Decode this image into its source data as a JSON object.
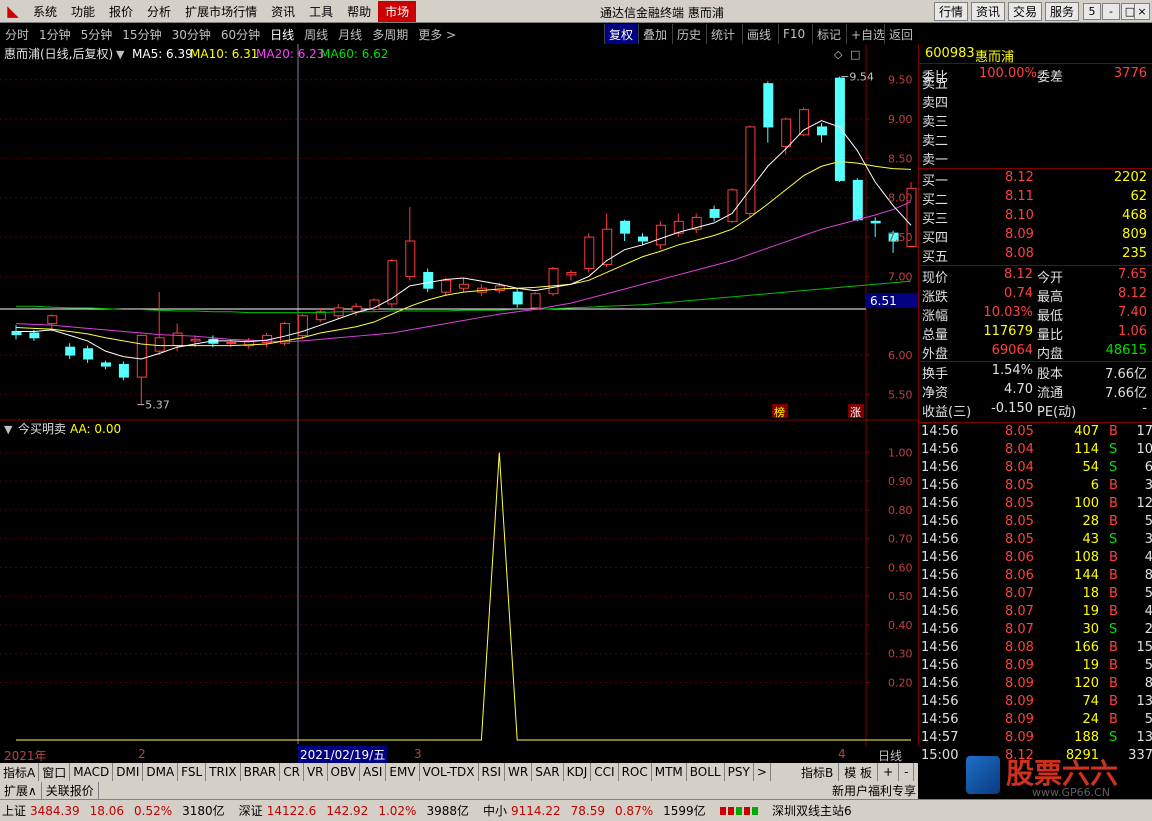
{
  "menubar": {
    "items": [
      "系统",
      "功能",
      "报价",
      "分析",
      "扩展市场行情",
      "资讯",
      "工具",
      "帮助",
      "市场"
    ],
    "title": "通达信金融终端 惠而浦",
    "right_buttons": [
      "行情",
      "资讯",
      "交易",
      "服务"
    ],
    "window_buttons": [
      "5",
      "-",
      "□",
      "×"
    ]
  },
  "toolbar": {
    "periods": [
      "分时",
      "1分钟",
      "5分钟",
      "15分钟",
      "30分钟",
      "60分钟",
      "日线",
      "周线",
      "月线",
      "多周期",
      "更多 >"
    ],
    "selected": "日线",
    "right_tools": [
      "复权",
      "叠加",
      "历史",
      "统计",
      "画线",
      "F10",
      "标记",
      "+自选",
      "返回"
    ]
  },
  "chart": {
    "stock_title": "惠而浦(日线,后复权)",
    "ma_labels": [
      {
        "text": "MA5: 6.39",
        "color": "#ffffff"
      },
      {
        "text": "MA10: 6.31",
        "color": "#ffff00"
      },
      {
        "text": "MA20: 6.23",
        "color": "#ff40ff"
      },
      {
        "text": "MA60: 6.62",
        "color": "#00e000"
      }
    ],
    "price_axis": [
      "9.50",
      "9.00",
      "8.50",
      "8.00",
      "7.50",
      "7.00",
      "6.51",
      "6.00",
      "5.50"
    ],
    "high_label": "9.54",
    "low_label": "5.37",
    "badges": [
      "榜",
      "涨"
    ],
    "indicator_title": "今买明卖",
    "indicator_value": "AA: 0.00",
    "indicator_axis": [
      "1.00",
      "0.90",
      "0.80",
      "0.70",
      "0.60",
      "0.50",
      "0.40",
      "0.30",
      "0.20"
    ],
    "date_labels": [
      "2021年",
      "2",
      "2021/02/19/五",
      "3",
      "4"
    ],
    "period_label": "日线"
  },
  "chart_data": {
    "type": "candlestick",
    "title": "惠而浦(日线,后复权)",
    "ylim": [
      5.2,
      9.7
    ],
    "candles": [
      {
        "o": 6.3,
        "c": 6.26,
        "h": 6.38,
        "l": 6.2
      },
      {
        "o": 6.28,
        "c": 6.22,
        "h": 6.32,
        "l": 6.18
      },
      {
        "o": 6.4,
        "c": 6.5,
        "h": 6.52,
        "l": 6.3
      },
      {
        "o": 6.1,
        "c": 6.0,
        "h": 6.15,
        "l": 5.95
      },
      {
        "o": 6.08,
        "c": 5.95,
        "h": 6.12,
        "l": 5.9
      },
      {
        "o": 5.9,
        "c": 5.86,
        "h": 5.93,
        "l": 5.82
      },
      {
        "o": 5.88,
        "c": 5.72,
        "h": 5.92,
        "l": 5.68
      },
      {
        "o": 5.72,
        "c": 6.25,
        "h": 6.26,
        "l": 5.37
      },
      {
        "o": 6.05,
        "c": 6.22,
        "h": 6.8,
        "l": 6.0
      },
      {
        "o": 6.12,
        "c": 6.28,
        "h": 6.4,
        "l": 6.05
      },
      {
        "o": 6.18,
        "c": 6.2,
        "h": 6.25,
        "l": 6.1
      },
      {
        "o": 6.2,
        "c": 6.15,
        "h": 6.25,
        "l": 6.1
      },
      {
        "o": 6.15,
        "c": 6.16,
        "h": 6.2,
        "l": 6.1
      },
      {
        "o": 6.12,
        "c": 6.18,
        "h": 6.22,
        "l": 6.08
      },
      {
        "o": 6.16,
        "c": 6.25,
        "h": 6.28,
        "l": 6.1
      },
      {
        "o": 6.15,
        "c": 6.4,
        "h": 6.42,
        "l": 6.12
      },
      {
        "o": 6.25,
        "c": 6.5,
        "h": 6.52,
        "l": 6.2
      },
      {
        "o": 6.45,
        "c": 6.55,
        "h": 6.6,
        "l": 6.42
      },
      {
        "o": 6.5,
        "c": 6.6,
        "h": 6.65,
        "l": 6.46
      },
      {
        "o": 6.55,
        "c": 6.62,
        "h": 6.66,
        "l": 6.5
      },
      {
        "o": 6.58,
        "c": 6.7,
        "h": 6.72,
        "l": 6.55
      },
      {
        "o": 6.65,
        "c": 7.2,
        "h": 7.22,
        "l": 6.6
      },
      {
        "o": 7.0,
        "c": 7.45,
        "h": 7.88,
        "l": 6.95
      },
      {
        "o": 7.05,
        "c": 6.85,
        "h": 7.1,
        "l": 6.8
      },
      {
        "o": 6.8,
        "c": 6.95,
        "h": 6.98,
        "l": 6.75
      },
      {
        "o": 6.85,
        "c": 6.9,
        "h": 6.98,
        "l": 6.8
      },
      {
        "o": 6.8,
        "c": 6.85,
        "h": 6.9,
        "l": 6.75
      },
      {
        "o": 6.82,
        "c": 6.88,
        "h": 6.92,
        "l": 6.78
      },
      {
        "o": 6.8,
        "c": 6.65,
        "h": 6.85,
        "l": 6.6
      },
      {
        "o": 6.6,
        "c": 6.78,
        "h": 6.8,
        "l": 6.58
      },
      {
        "o": 6.78,
        "c": 7.1,
        "h": 7.12,
        "l": 6.75
      },
      {
        "o": 7.02,
        "c": 7.05,
        "h": 7.08,
        "l": 6.95
      },
      {
        "o": 7.1,
        "c": 7.5,
        "h": 7.55,
        "l": 7.05
      },
      {
        "o": 7.15,
        "c": 7.6,
        "h": 7.8,
        "l": 7.12
      },
      {
        "o": 7.7,
        "c": 7.55,
        "h": 7.72,
        "l": 7.45
      },
      {
        "o": 7.5,
        "c": 7.45,
        "h": 7.55,
        "l": 7.4
      },
      {
        "o": 7.4,
        "c": 7.65,
        "h": 7.7,
        "l": 7.35
      },
      {
        "o": 7.55,
        "c": 7.7,
        "h": 7.8,
        "l": 7.5
      },
      {
        "o": 7.6,
        "c": 7.75,
        "h": 7.8,
        "l": 7.55
      },
      {
        "o": 7.85,
        "c": 7.75,
        "h": 7.9,
        "l": 7.7
      },
      {
        "o": 7.7,
        "c": 8.1,
        "h": 8.12,
        "l": 7.68
      },
      {
        "o": 7.8,
        "c": 8.9,
        "h": 8.92,
        "l": 7.75
      },
      {
        "o": 9.45,
        "c": 8.9,
        "h": 9.48,
        "l": 8.7
      },
      {
        "o": 8.65,
        "c": 9.0,
        "h": 9.02,
        "l": 8.55
      },
      {
        "o": 8.8,
        "c": 9.12,
        "h": 9.15,
        "l": 8.78
      },
      {
        "o": 8.9,
        "c": 8.8,
        "h": 8.95,
        "l": 8.7
      },
      {
        "o": 9.52,
        "c": 8.22,
        "h": 9.54,
        "l": 8.2
      },
      {
        "o": 8.22,
        "c": 7.72,
        "h": 8.25,
        "l": 7.7
      },
      {
        "o": 7.7,
        "c": 7.68,
        "h": 7.75,
        "l": 7.5
      },
      {
        "o": 7.55,
        "c": 7.45,
        "h": 7.58,
        "l": 7.3
      },
      {
        "o": 7.38,
        "c": 8.12,
        "h": 8.2,
        "l": 7.38
      }
    ],
    "ma5": [
      6.3,
      6.3,
      6.32,
      6.25,
      6.18,
      6.05,
      5.98,
      5.95,
      6.02,
      6.1,
      6.14,
      6.18,
      6.18,
      6.17,
      6.19,
      6.24,
      6.3,
      6.38,
      6.46,
      6.54,
      6.6,
      6.72,
      6.88,
      6.92,
      6.96,
      6.98,
      6.94,
      6.9,
      6.85,
      6.82,
      6.86,
      6.9,
      7.0,
      7.2,
      7.34,
      7.4,
      7.48,
      7.56,
      7.62,
      7.68,
      7.8,
      8.1,
      8.4,
      8.62,
      8.86,
      8.98,
      8.9,
      8.6,
      8.2,
      7.9,
      7.65
    ],
    "ma10": [
      6.35,
      6.34,
      6.33,
      6.3,
      6.27,
      6.22,
      6.18,
      6.14,
      6.12,
      6.12,
      6.12,
      6.12,
      6.12,
      6.13,
      6.14,
      6.18,
      6.22,
      6.28,
      6.32,
      6.36,
      6.42,
      6.52,
      6.62,
      6.7,
      6.76,
      6.8,
      6.82,
      6.84,
      6.85,
      6.86,
      6.88,
      6.9,
      6.95,
      7.05,
      7.15,
      7.25,
      7.32,
      7.4,
      7.46,
      7.52,
      7.6,
      7.75,
      7.92,
      8.1,
      8.28,
      8.4,
      8.46,
      8.44,
      8.4,
      8.37,
      8.36
    ],
    "ma20": [
      6.4,
      6.39,
      6.38,
      6.36,
      6.34,
      6.32,
      6.3,
      6.28,
      6.26,
      6.25,
      6.24,
      6.22,
      6.2,
      6.19,
      6.18,
      6.17,
      6.18,
      6.2,
      6.22,
      6.24,
      6.26,
      6.28,
      6.32,
      6.36,
      6.4,
      6.44,
      6.48,
      6.52,
      6.55,
      6.58,
      6.62,
      6.66,
      6.72,
      6.78,
      6.84,
      6.9,
      6.96,
      7.02,
      7.08,
      7.14,
      7.2,
      7.28,
      7.36,
      7.44,
      7.52,
      7.6,
      7.66,
      7.72,
      7.78,
      7.85,
      7.95
    ],
    "ma60": [
      6.62,
      6.62,
      6.61,
      6.6,
      6.6,
      6.59,
      6.58,
      6.58,
      6.57,
      6.56,
      6.56,
      6.55,
      6.55,
      6.54,
      6.54,
      6.54,
      6.54,
      6.54,
      6.55,
      6.55,
      6.55,
      6.56,
      6.56,
      6.56,
      6.56,
      6.57,
      6.57,
      6.57,
      6.58,
      6.58,
      6.59,
      6.6,
      6.61,
      6.62,
      6.63,
      6.64,
      6.66,
      6.68,
      6.7,
      6.72,
      6.74,
      6.76,
      6.78,
      6.8,
      6.82,
      6.84,
      6.86,
      6.88,
      6.9,
      6.92,
      6.94
    ],
    "indicator": {
      "name": "AA",
      "ylim": [
        0,
        1.05
      ],
      "spike_index": 27,
      "spike_value": 1.0
    }
  },
  "quote": {
    "code": "600983",
    "name": "惠而浦",
    "weibi": {
      "label": "委比",
      "value": "100.00%",
      "label2": "委差",
      "value2": "3776"
    },
    "sell": [
      {
        "label": "卖五",
        "price": "",
        "vol": ""
      },
      {
        "label": "卖四",
        "price": "",
        "vol": ""
      },
      {
        "label": "卖三",
        "price": "",
        "vol": ""
      },
      {
        "label": "卖二",
        "price": "",
        "vol": ""
      },
      {
        "label": "卖一",
        "price": "",
        "vol": ""
      }
    ],
    "buy": [
      {
        "label": "买一",
        "price": "8.12",
        "vol": "2202"
      },
      {
        "label": "买二",
        "price": "8.11",
        "vol": "62"
      },
      {
        "label": "买三",
        "price": "8.10",
        "vol": "468"
      },
      {
        "label": "买四",
        "price": "8.09",
        "vol": "809"
      },
      {
        "label": "买五",
        "price": "8.08",
        "vol": "235"
      }
    ],
    "stats": [
      {
        "l1": "现价",
        "v1": "8.12",
        "c1": "red",
        "l2": "今开",
        "v2": "7.65",
        "c2": "red"
      },
      {
        "l1": "涨跌",
        "v1": "0.74",
        "c1": "red",
        "l2": "最高",
        "v2": "8.12",
        "c2": "red"
      },
      {
        "l1": "涨幅",
        "v1": "10.03%",
        "c1": "red",
        "l2": "最低",
        "v2": "7.40",
        "c2": "red"
      },
      {
        "l1": "总量",
        "v1": "117679",
        "c1": "yellow",
        "l2": "量比",
        "v2": "1.06",
        "c2": "red"
      },
      {
        "l1": "外盘",
        "v1": "69064",
        "c1": "red",
        "l2": "内盘",
        "v2": "48615",
        "c2": "green"
      }
    ],
    "stats2": [
      {
        "l1": "换手",
        "v1": "1.54%",
        "l2": "股本",
        "v2": "7.66亿"
      },
      {
        "l1": "净资",
        "v1": "4.70",
        "l2": "流通",
        "v2": "7.66亿"
      },
      {
        "l1": "收益(三)",
        "v1": "-0.150",
        "l2": "PE(动)",
        "v2": "-"
      }
    ],
    "ticks": [
      {
        "t": "14:56",
        "p": "8.05",
        "v": "407",
        "d": "B",
        "n": "17"
      },
      {
        "t": "14:56",
        "p": "8.04",
        "v": "114",
        "d": "S",
        "n": "10"
      },
      {
        "t": "14:56",
        "p": "8.04",
        "v": "54",
        "d": "S",
        "n": "6"
      },
      {
        "t": "14:56",
        "p": "8.05",
        "v": "6",
        "d": "B",
        "n": "3"
      },
      {
        "t": "14:56",
        "p": "8.05",
        "v": "100",
        "d": "B",
        "n": "12"
      },
      {
        "t": "14:56",
        "p": "8.05",
        "v": "28",
        "d": "B",
        "n": "5"
      },
      {
        "t": "14:56",
        "p": "8.05",
        "v": "43",
        "d": "S",
        "n": "3"
      },
      {
        "t": "14:56",
        "p": "8.06",
        "v": "108",
        "d": "B",
        "n": "4"
      },
      {
        "t": "14:56",
        "p": "8.06",
        "v": "144",
        "d": "B",
        "n": "8"
      },
      {
        "t": "14:56",
        "p": "8.07",
        "v": "18",
        "d": "B",
        "n": "5"
      },
      {
        "t": "14:56",
        "p": "8.07",
        "v": "19",
        "d": "B",
        "n": "4"
      },
      {
        "t": "14:56",
        "p": "8.07",
        "v": "30",
        "d": "S",
        "n": "2"
      },
      {
        "t": "14:56",
        "p": "8.08",
        "v": "166",
        "d": "B",
        "n": "15"
      },
      {
        "t": "14:56",
        "p": "8.09",
        "v": "19",
        "d": "B",
        "n": "5"
      },
      {
        "t": "14:56",
        "p": "8.09",
        "v": "120",
        "d": "B",
        "n": "8"
      },
      {
        "t": "14:56",
        "p": "8.09",
        "v": "74",
        "d": "B",
        "n": "13"
      },
      {
        "t": "14:56",
        "p": "8.09",
        "v": "24",
        "d": "B",
        "n": "5"
      },
      {
        "t": "14:57",
        "p": "8.09",
        "v": "188",
        "d": "S",
        "n": "13"
      },
      {
        "t": "15:00",
        "p": "8.12",
        "v": "8291",
        "d": "",
        "n": "337"
      }
    ]
  },
  "tabs": {
    "left": [
      "指标A",
      "窗口",
      "MACD",
      "DMI",
      "DMA",
      "FSL",
      "TRIX",
      "BRAR",
      "CR",
      "VR",
      "OBV",
      "ASI",
      "EMV",
      "VOL-TDX",
      "RSI",
      "WR",
      "SAR",
      "KDJ",
      "CCI",
      "ROC",
      "MTM",
      "BOLL",
      "PSY",
      ">"
    ],
    "right": [
      "指标B",
      "模 板",
      "+",
      "-"
    ]
  },
  "ext": {
    "items": [
      "扩展∧",
      "关联报价"
    ],
    "right": "新用户福利专享"
  },
  "status": {
    "sh": {
      "label": "上证",
      "val": "3484.39",
      "chg": "18.06",
      "pct": "0.52%",
      "amt": "3180亿"
    },
    "sz": {
      "label": "深证",
      "val": "14122.6",
      "chg": "142.92",
      "pct": "1.02%",
      "amt": "3988亿"
    },
    "zx": {
      "label": "中小",
      "val": "9114.22",
      "chg": "78.59",
      "pct": "0.87%",
      "amt": "1599亿"
    },
    "site": "深圳双线主站6"
  },
  "watermark": {
    "text": "股票六六",
    "url": "www.GP66.CN"
  }
}
